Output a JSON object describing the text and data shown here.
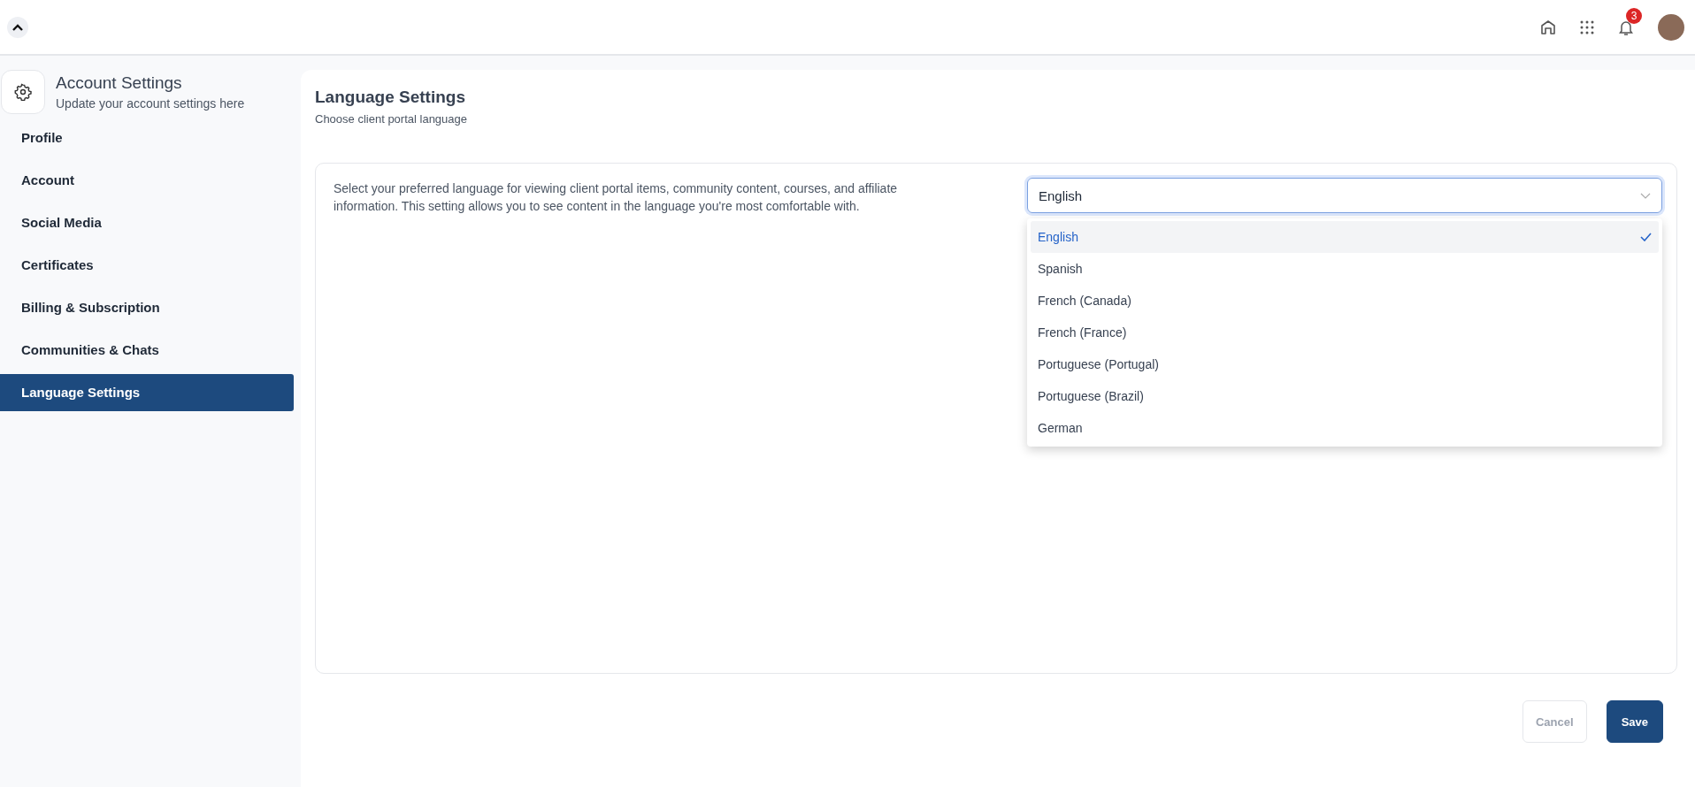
{
  "header": {
    "notification_count": "3"
  },
  "sidebar": {
    "title": "Account Settings",
    "subtitle": "Update your account settings here",
    "items": [
      {
        "label": "Profile",
        "selected": false
      },
      {
        "label": "Account",
        "selected": false
      },
      {
        "label": "Social Media",
        "selected": false
      },
      {
        "label": "Certificates",
        "selected": false
      },
      {
        "label": "Billing & Subscription",
        "selected": false
      },
      {
        "label": "Communities & Chats",
        "selected": false
      },
      {
        "label": "Language Settings",
        "selected": true
      }
    ]
  },
  "content": {
    "title": "Language Settings",
    "subtitle": "Choose client portal language",
    "description": "Select your preferred language for viewing client portal items, community content, courses, and affiliate information. This setting allows you to see content in the language you're most comfortable with.",
    "select": {
      "value": "English",
      "expanded": true,
      "options": [
        {
          "label": "English",
          "selected": true
        },
        {
          "label": "Spanish",
          "selected": false
        },
        {
          "label": "French (Canada)",
          "selected": false
        },
        {
          "label": "French (France)",
          "selected": false
        },
        {
          "label": "Portuguese (Portugal)",
          "selected": false
        },
        {
          "label": "Portuguese (Brazil)",
          "selected": false
        },
        {
          "label": "German",
          "selected": false
        }
      ]
    }
  },
  "buttons": [
    {
      "label": "Cancel",
      "kind": "secondary",
      "disabled": true
    },
    {
      "label": "Save",
      "kind": "primary",
      "disabled": false
    }
  ]
}
